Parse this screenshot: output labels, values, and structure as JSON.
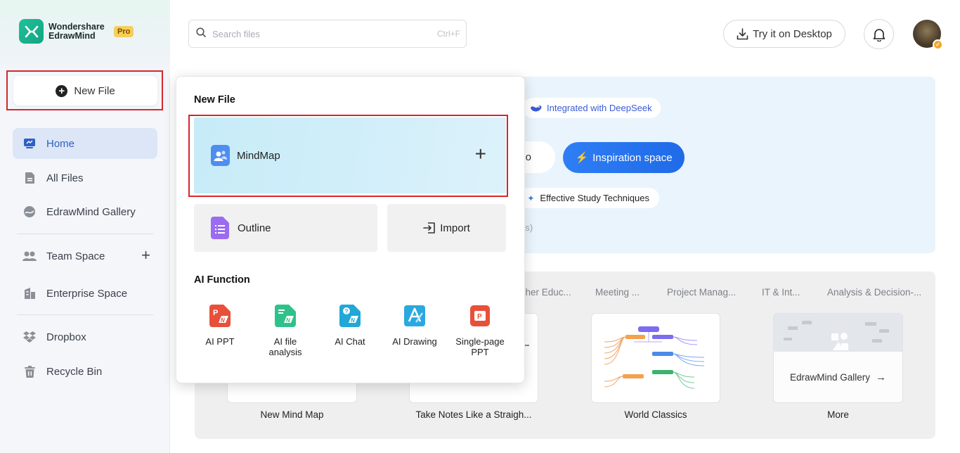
{
  "app": {
    "logo_line1": "Wondershare",
    "logo_line2": "EdrawMind",
    "badge": "Pro",
    "accent": "#1fc19c"
  },
  "sidebar": {
    "new_file_label": "New File",
    "items": [
      {
        "label": "Home",
        "icon": "home-icon",
        "active": true
      },
      {
        "label": "All Files",
        "icon": "file-icon"
      },
      {
        "label": "EdrawMind Gallery",
        "icon": "gallery-icon"
      },
      {
        "label": "Team Space",
        "icon": "team-icon"
      },
      {
        "label": "Enterprise Space",
        "icon": "enterprise-icon"
      },
      {
        "label": "Dropbox",
        "icon": "dropbox-icon"
      },
      {
        "label": "Recycle Bin",
        "icon": "trash-icon"
      }
    ]
  },
  "header": {
    "search_placeholder": "Search files",
    "search_shortcut": "Ctrl+F",
    "try_desktop": "Try it on Desktop"
  },
  "hero": {
    "deepseek": "Integrated with DeepSeek",
    "partial_button": "o",
    "inspiration": "Inspiration space",
    "study_pill": "Effective Study Techniques",
    "faint_text": "ns)",
    "primary_color": "#2f7ef5"
  },
  "templates": {
    "categories": [
      "gher Educ...",
      "Meeting ...",
      "Project Manag...",
      "IT & Int...",
      "Analysis & Decision-..."
    ],
    "cards": [
      "New Mind Map",
      "Take Notes Like a Straigh...",
      "World Classics",
      "More"
    ],
    "gallery_overlay": "EdrawMind Gallery"
  },
  "popup": {
    "title": "New File",
    "mindmap": "MindMap",
    "outline": "Outline",
    "import": "Import",
    "ai_title": "AI Function",
    "ai_items": [
      {
        "label": "AI PPT",
        "icon": "ai-ppt-icon",
        "color": "#e8503a"
      },
      {
        "label": "AI file analysis",
        "icon": "ai-file-analysis-icon",
        "color": "#2ec28b"
      },
      {
        "label": "AI Chat",
        "icon": "ai-chat-icon",
        "color": "#21a7d8"
      },
      {
        "label": "AI Drawing",
        "icon": "ai-drawing-icon",
        "color": "#2aa8e0"
      },
      {
        "label": "Single-page PPT",
        "icon": "single-page-ppt-icon",
        "color": "#e8503a"
      }
    ]
  }
}
